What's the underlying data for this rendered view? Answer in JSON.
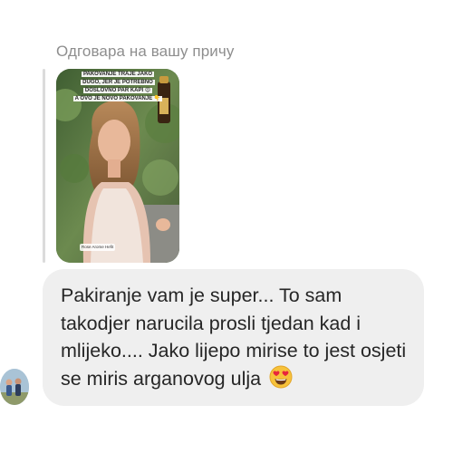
{
  "thread": {
    "reply_label": "Одговара на вашу причу"
  },
  "story": {
    "caption_lines": [
      "PAKOVANJE TRAJE JAKO",
      "DUGO, JER JE POTREBNO",
      "DOSLOVNO PAR KAPI 😍",
      "A OVO JE NOVO PAKOVANJE 👇"
    ],
    "handle": "Rose Arome Hefit"
  },
  "message": {
    "text": "Pakiranje vam je super... To sam takodjer narucila prosli tjedan kad i mlijeko.... Jako lijepo mirise to jest osjeti se miris arganovog ulja",
    "emoji_icon": "smiling-face-with-heart-eyes-icon"
  },
  "sender": {
    "avatar_icon": "user-avatar-icon"
  }
}
